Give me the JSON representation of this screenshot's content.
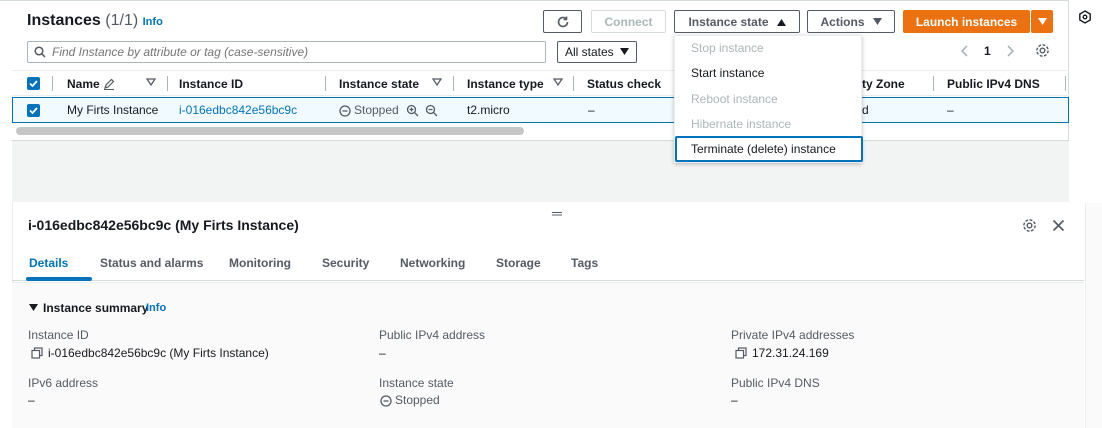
{
  "header": {
    "title": "Instances",
    "count": "(1/1)",
    "info": "Info"
  },
  "toolbar": {
    "connect": "Connect",
    "instance_state": "Instance state",
    "actions": "Actions",
    "launch": "Launch instances"
  },
  "search": {
    "placeholder": "Find Instance by attribute or tag (case-sensitive)"
  },
  "filter": {
    "selected": "All states"
  },
  "pagination": {
    "page": "1"
  },
  "table": {
    "columns": [
      "Name",
      "Instance ID",
      "Instance state",
      "Instance type",
      "Status check",
      "ty Zone",
      "Public IPv4 DNS"
    ],
    "row": {
      "name": "My Firts Instance",
      "instance_id": "i-016edbc842e56bc9c",
      "state": "Stopped",
      "type": "t2.micro",
      "status_check": "–",
      "zone_fragment": "d",
      "public_dns": "–"
    }
  },
  "instance_state_menu": {
    "items": [
      {
        "label": "Stop instance",
        "enabled": false
      },
      {
        "label": "Start instance",
        "enabled": true
      },
      {
        "label": "Reboot instance",
        "enabled": false
      },
      {
        "label": "Hibernate instance",
        "enabled": false
      },
      {
        "label": "Terminate (delete) instance",
        "enabled": true
      }
    ]
  },
  "details": {
    "title": "i-016edbc842e56bc9c (My Firts Instance)",
    "tabs": [
      "Details",
      "Status and alarms",
      "Monitoring",
      "Security",
      "Networking",
      "Storage",
      "Tags"
    ],
    "summary_heading": "Instance summary",
    "summary_info": "Info",
    "fields": {
      "instance_id_label": "Instance ID",
      "instance_id_value": "i-016edbc842e56bc9c (My Firts Instance)",
      "public_ipv4_label": "Public IPv4 address",
      "public_ipv4_value": "–",
      "private_ipv4_label": "Private IPv4 addresses",
      "private_ipv4_value": "172.31.24.169",
      "ipv6_label": "IPv6 address",
      "ipv6_value": "–",
      "instance_state_label": "Instance state",
      "instance_state_value": "Stopped",
      "public_dns_label": "Public IPv4 DNS",
      "public_dns_value": "–"
    }
  },
  "colors": {
    "accent": "#0073bb",
    "primary_button": "#ec7211",
    "text": "#16191f",
    "muted": "#545b64"
  }
}
